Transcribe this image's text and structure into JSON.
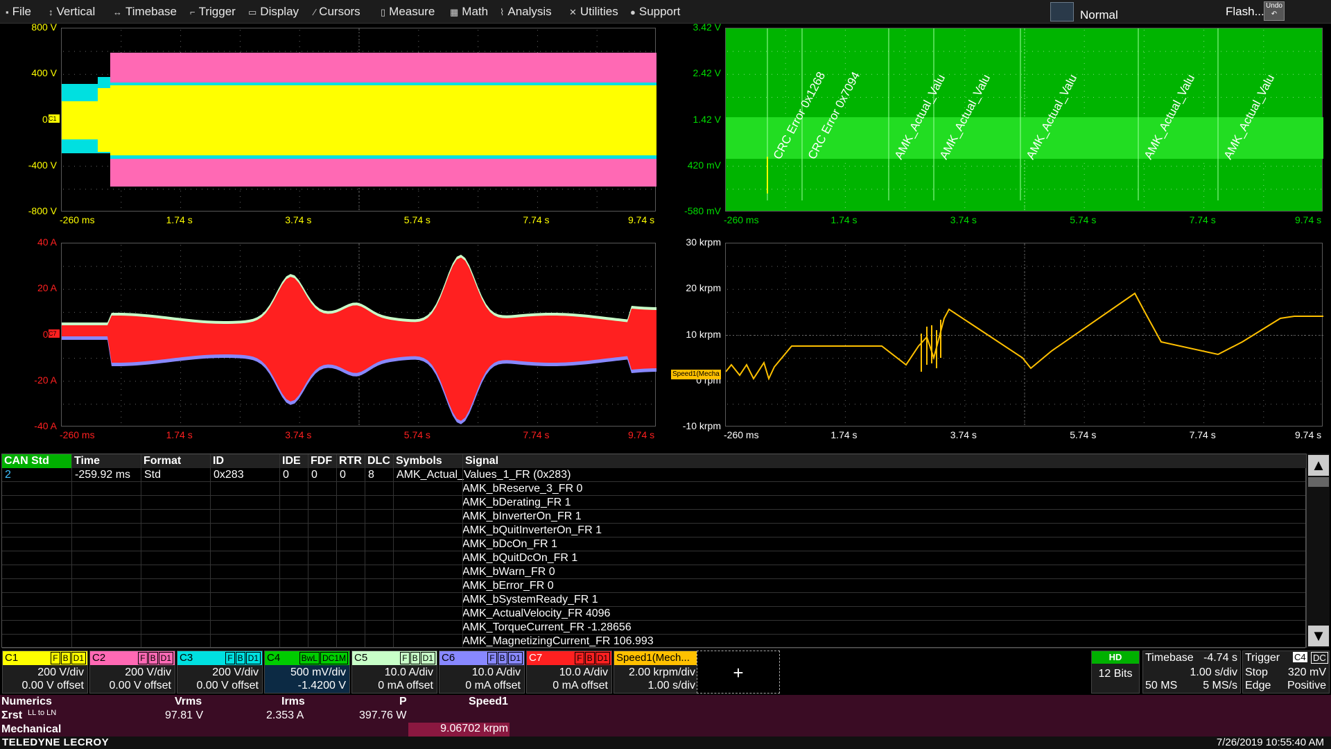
{
  "menu": [
    {
      "label": "File",
      "icon": "file-icon",
      "glyph": "▪"
    },
    {
      "label": "Vertical",
      "icon": "vertical-arrows-icon",
      "glyph": "↕"
    },
    {
      "label": "Timebase",
      "icon": "horizontal-arrows-icon",
      "glyph": "↔"
    },
    {
      "label": "Trigger",
      "icon": "trigger-icon",
      "glyph": "⌐"
    },
    {
      "label": "Display",
      "icon": "display-icon",
      "glyph": "▭"
    },
    {
      "label": "Cursors",
      "icon": "cursors-icon",
      "glyph": "⁄"
    },
    {
      "label": "Measure",
      "icon": "measure-icon",
      "glyph": "▯"
    },
    {
      "label": "Math",
      "icon": "math-icon",
      "glyph": "▦"
    },
    {
      "label": "Analysis",
      "icon": "analysis-icon",
      "glyph": "⌇"
    },
    {
      "label": "Utilities",
      "icon": "tools-icon",
      "glyph": "✕"
    },
    {
      "label": "Support",
      "icon": "support-icon",
      "glyph": "●"
    }
  ],
  "header": {
    "trigger_mode": "Normal",
    "flash": "Flash...",
    "undo": "Undo"
  },
  "grids": {
    "g1": {
      "y_labels": [
        "800 V",
        "400 V",
        "0 V",
        "-400 V",
        "-800 V"
      ],
      "x_labels": [
        "-260 ms",
        "1.74 s",
        "3.74 s",
        "5.74 s",
        "7.74 s",
        "9.74 s"
      ],
      "color": "#ffff00",
      "marker": "C1"
    },
    "g2": {
      "y_labels": [
        "3.42 V",
        "2.42 V",
        "1.42 V",
        "420 mV",
        "-580 mV"
      ],
      "x_labels": [
        "-260 ms",
        "1.74 s",
        "3.74 s",
        "5.74 s",
        "7.74 s",
        "9.74 s"
      ],
      "color": "#00cc00",
      "marker": "C4",
      "annotations": [
        "CRC Error 0x1268",
        "CRC Error 0x7094",
        "AMK_Actual_Valu",
        "AMK_Actual_Valu",
        "AMK_Actual_Valu",
        "AMK_Actual_Valu",
        "AMK_Actual_Valu"
      ]
    },
    "g3": {
      "y_labels": [
        "40 A",
        "20 A",
        "0 A",
        "-20 A",
        "-40 A"
      ],
      "x_labels": [
        "-260 ms",
        "1.74 s",
        "3.74 s",
        "5.74 s",
        "7.74 s",
        "9.74 s"
      ],
      "color": "#ff2020",
      "marker": "C7"
    },
    "g4": {
      "y_labels": [
        "30 krpm",
        "20 krpm",
        "10 krpm",
        "0 rpm",
        "-10 krpm"
      ],
      "x_labels": [
        "-260 ms",
        "1.74 s",
        "3.74 s",
        "5.74 s",
        "7.74 s",
        "9.74 s"
      ],
      "color": "#ffc000",
      "marker": "Speed1(Mecha"
    }
  },
  "table": {
    "headers": [
      "CAN Std",
      "Time",
      "Format",
      "ID",
      "IDE",
      "FDF",
      "RTR",
      "DLC",
      "Symbols",
      "Signal"
    ],
    "row": {
      "idx": "2",
      "time": "-259.92 ms",
      "format": "Std",
      "id": "0x283",
      "ide": "0",
      "fdf": "0",
      "rtr": "0",
      "dlc": "8",
      "symbols": "AMK_Actual_Values_1_FR  (0x283)"
    },
    "signals": [
      "AMK_bReserve_3_FR 0",
      "AMK_bDerating_FR 1",
      "AMK_bInverterOn_FR 1",
      "AMK_bQuitInverterOn_FR 1",
      "AMK_bDcOn_FR 1",
      "AMK_bQuitDcOn_FR 1",
      "AMK_bWarn_FR 0",
      "AMK_bError_FR 0",
      "AMK_bSystemReady_FR 1",
      "AMK_ActualVelocity_FR 4096",
      "AMK_TorqueCurrent_FR -1.28656",
      "AMK_MagnetizingCurrent_FR 106.993"
    ]
  },
  "channels": [
    {
      "name": "C1",
      "flags": [
        "F",
        "B",
        "D1"
      ],
      "scale": "200 V/div",
      "offset": "0.00 V offset",
      "color": "#ffff00"
    },
    {
      "name": "C2",
      "flags": [
        "F",
        "B",
        "D1"
      ],
      "scale": "200 V/div",
      "offset": "0.00 V offset",
      "color": "#ff69b4"
    },
    {
      "name": "C3",
      "flags": [
        "F",
        "B",
        "D1"
      ],
      "scale": "200 V/div",
      "offset": "0.00 V offset",
      "color": "#00e0e0"
    },
    {
      "name": "C4",
      "flags": [
        "BwL",
        "DC1M"
      ],
      "scale": "500 mV/div",
      "offset": "-1.4200 V",
      "color": "#00cc00"
    },
    {
      "name": "C5",
      "flags": [
        "F",
        "B",
        "D1"
      ],
      "scale": "10.0 A/div",
      "offset": "0 mA offset",
      "color": "#c8ffc8"
    },
    {
      "name": "C6",
      "flags": [
        "F",
        "B",
        "D1"
      ],
      "scale": "10.0 A/div",
      "offset": "0 mA offset",
      "color": "#8888ff"
    },
    {
      "name": "C7",
      "flags": [
        "F",
        "B",
        "D1"
      ],
      "scale": "10.0 A/div",
      "offset": "0 mA offset",
      "color": "#ff2020"
    },
    {
      "name": "Speed1(Mech...",
      "flags": [],
      "scale": "2.00 krpm/div",
      "offset": "1.00 s/div",
      "color": "#ffc000"
    }
  ],
  "add_channel": "+",
  "acq": {
    "hd": "HD",
    "bits": "12 Bits",
    "timebase_label": "Timebase",
    "timebase_val": "-4.74 s",
    "sdiv": "1.00 s/div",
    "ms": "50 MS",
    "rate": "5 MS/s",
    "trigger_label": "Trigger",
    "trig_ch": "C4",
    "trig_cpl": "DC",
    "trig_stop": "Stop",
    "trig_level": "320 mV",
    "trig_edge": "Edge",
    "trig_slope": "Positive"
  },
  "numerics": {
    "title": "Numerics",
    "vrms_h": "Vrms",
    "irms_h": "Irms",
    "p_h": "P",
    "speed_h": "Speed1",
    "row_label": "Σrst",
    "row_sub": "LL to LN",
    "vrms": "97.81 V",
    "irms": "2.353 A",
    "p": "397.76 W",
    "mech_label": "Mechanical",
    "speed": "9.06702 krpm"
  },
  "footer": {
    "brand": "TELEDYNE LECROY",
    "datetime": "7/26/2019 10:55:40 AM"
  }
}
